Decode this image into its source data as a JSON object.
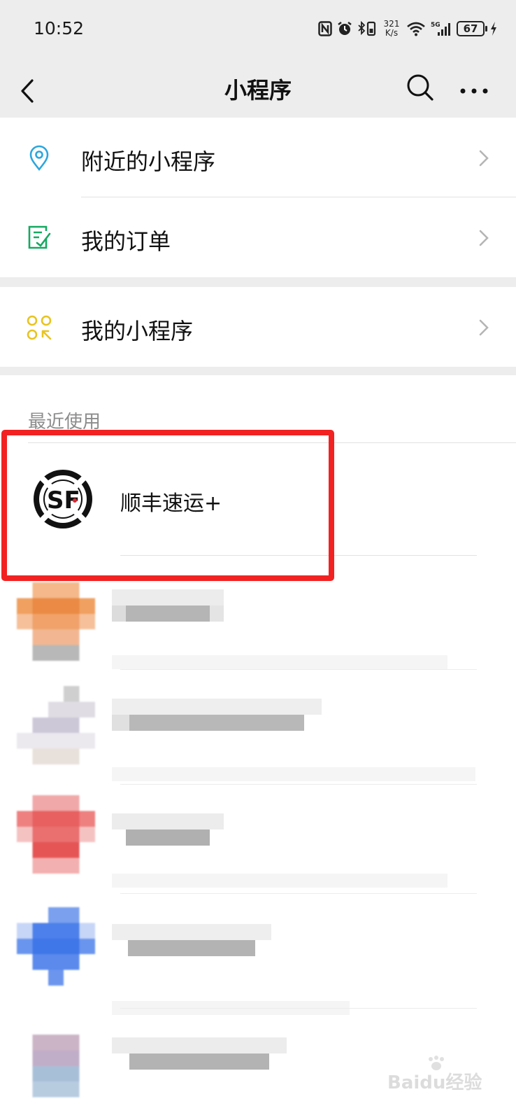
{
  "status_bar": {
    "time": "10:52",
    "net_speed_value": "321",
    "net_speed_unit": "K/s",
    "network": "5G",
    "battery": "67"
  },
  "nav": {
    "title": "小程序"
  },
  "menu": {
    "nearby": "附近的小程序",
    "orders": "我的订单",
    "my_mini_programs": "我的小程序"
  },
  "recent": {
    "section_label": "最近使用",
    "items": [
      {
        "name": "顺丰速运+",
        "logo_text": "SF"
      }
    ]
  },
  "watermark": "Baidu经验",
  "colors": {
    "accent_location": "#2ba6de",
    "accent_orders": "#15a961",
    "accent_mine": "#e8c420",
    "highlight": "#f22222"
  }
}
